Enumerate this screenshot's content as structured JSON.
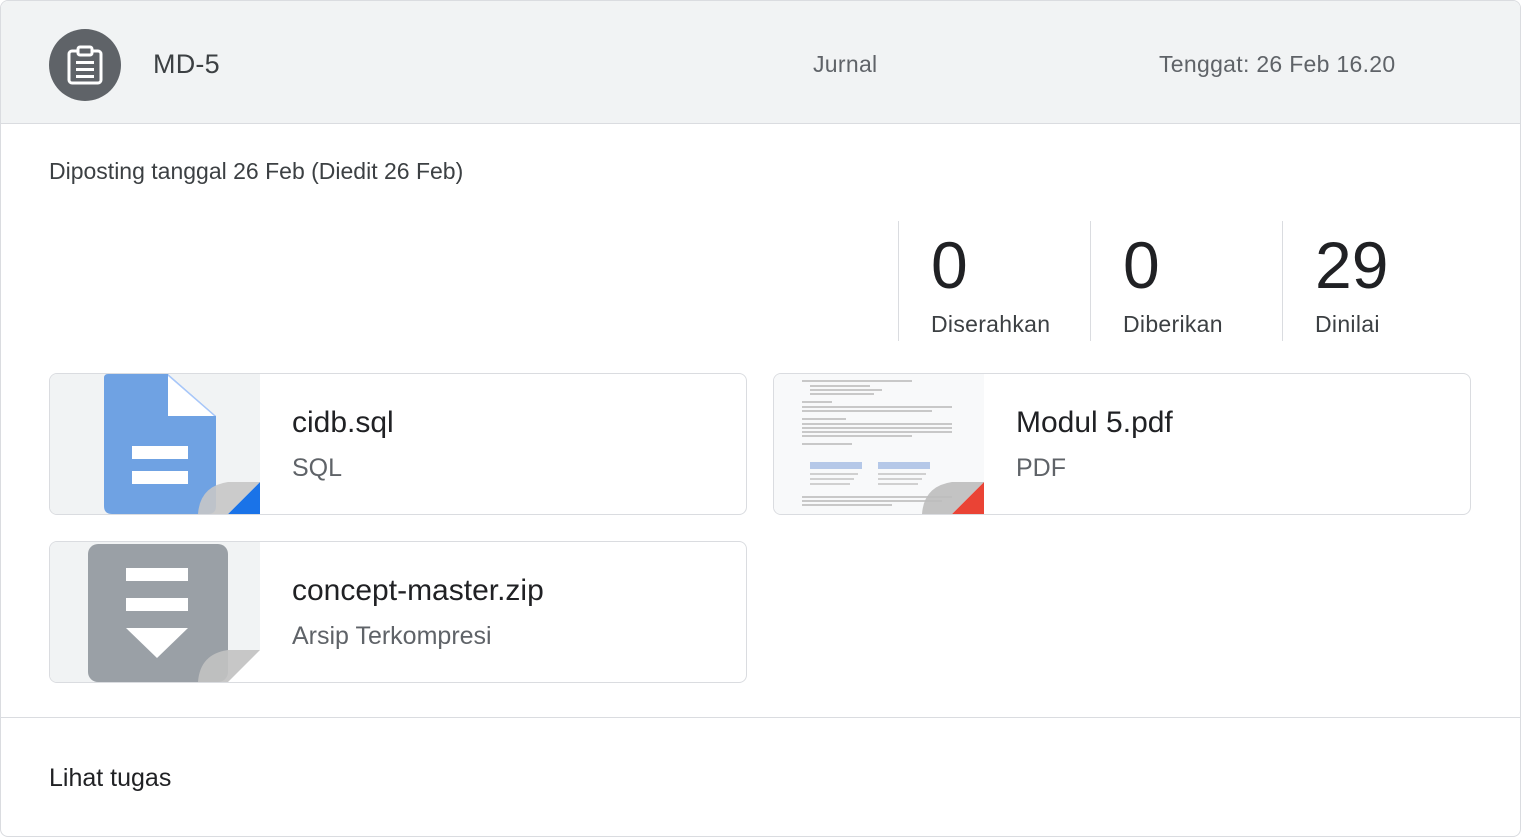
{
  "assignment": {
    "title": "MD-5",
    "category": "Jurnal",
    "due": "Tenggat: 26 Feb 16.20",
    "posted": "Diposting tanggal 26 Feb (Diedit 26 Feb)",
    "icon": "assignment-icon"
  },
  "stats": [
    {
      "value": "0",
      "label": "Diserahkan"
    },
    {
      "value": "0",
      "label": "Diberikan"
    },
    {
      "value": "29",
      "label": "Dinilai"
    }
  ],
  "attachments": [
    {
      "name": "cidb.sql",
      "type": "SQL",
      "icon": "google-docs-icon",
      "accent": "#1a73e8"
    },
    {
      "name": "Modul 5.pdf",
      "type": "PDF",
      "icon": "pdf-thumbnail",
      "accent": "#ea4335"
    },
    {
      "name": "concept-master.zip",
      "type": "Arsip Terkompresi",
      "icon": "archive-icon",
      "accent": "#9aa0a6"
    }
  ],
  "footer": {
    "view_label": "Lihat tugas"
  },
  "colors": {
    "header_bg": "#f1f3f4",
    "avatar_bg": "#5f6368",
    "doc_blue": "#6fa2e3"
  }
}
